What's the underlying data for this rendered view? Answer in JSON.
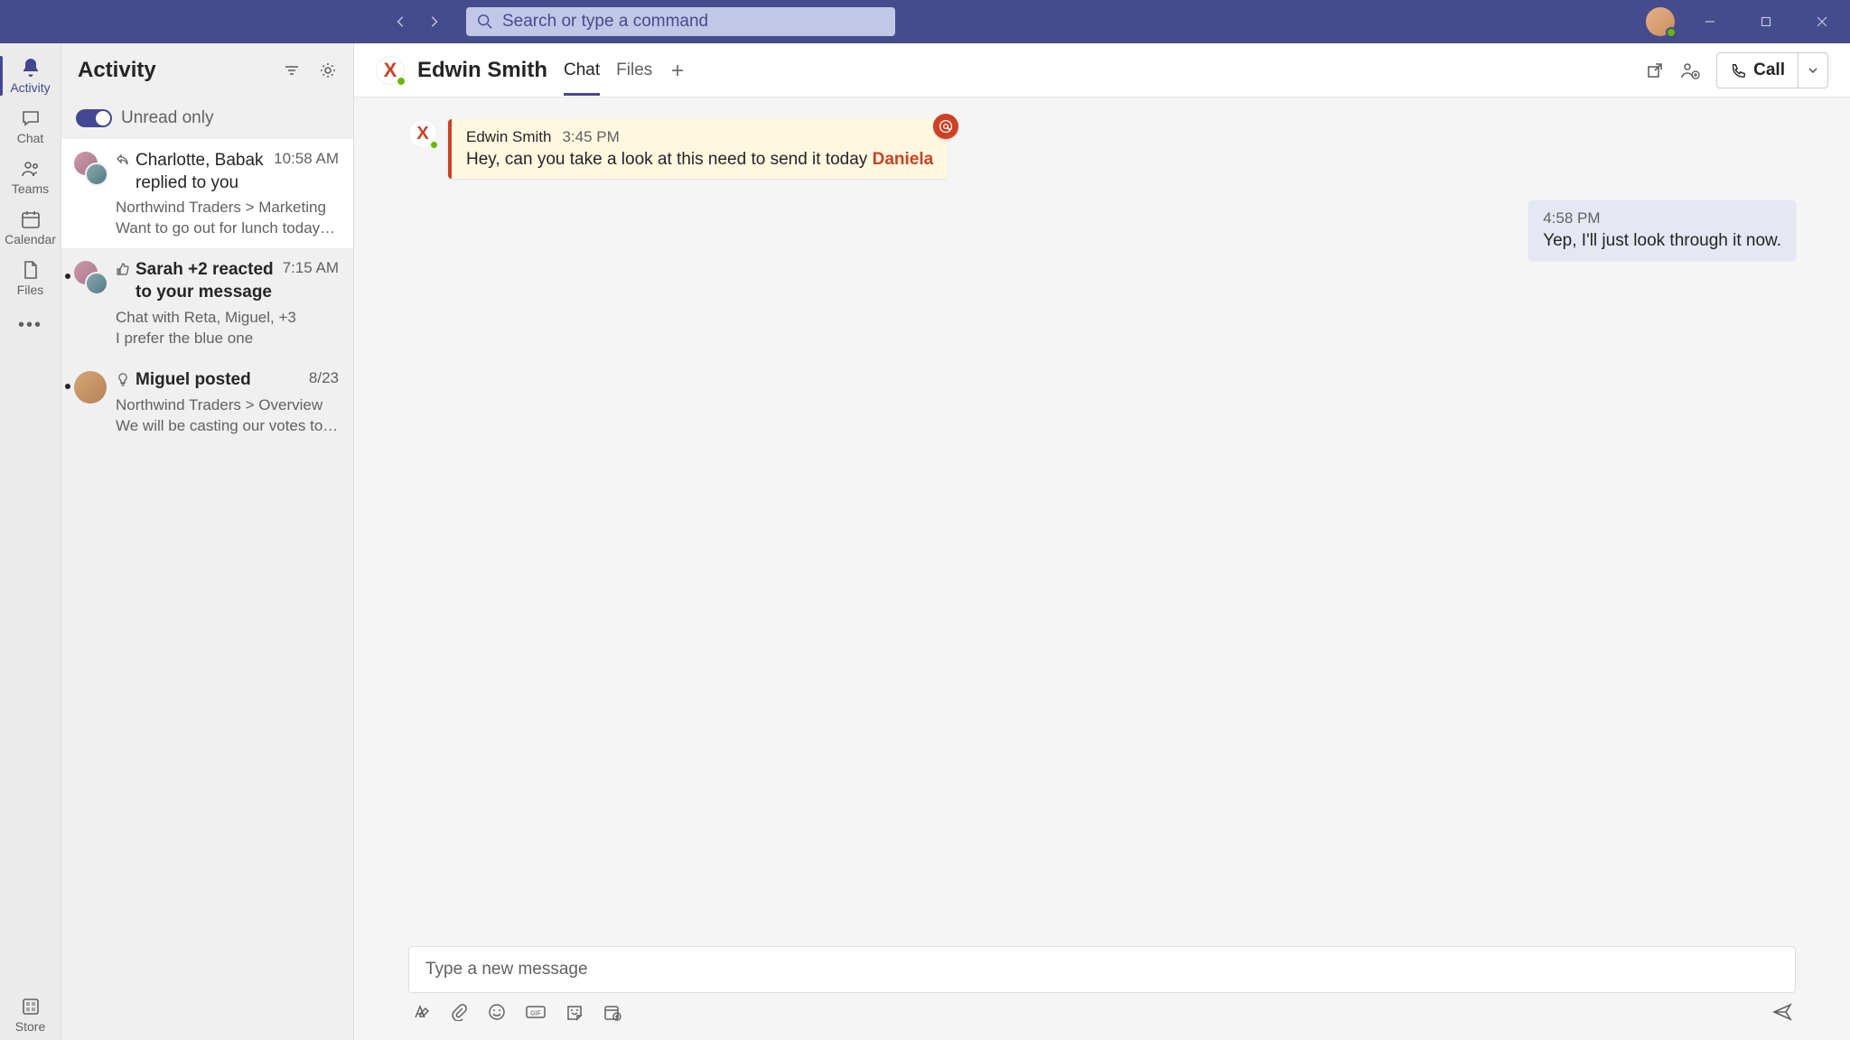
{
  "search": {
    "placeholder": "Search or type a command"
  },
  "rail": {
    "activity": "Activity",
    "chat": "Chat",
    "teams": "Teams",
    "calendar": "Calendar",
    "files": "Files",
    "store": "Store"
  },
  "activity": {
    "title": "Activity",
    "unread_label": "Unread only",
    "items": [
      {
        "heading": "Charlotte, Babak replied to you",
        "time": "10:58 AM",
        "sub": "Northwind Traders > Marketing",
        "preview": "Want to go out for lunch today? It's my…",
        "bold": false,
        "selected": true,
        "dot": false
      },
      {
        "heading": "Sarah +2 reacted to your message",
        "time": "7:15 AM",
        "sub": "Chat with Reta, Miguel, +3",
        "preview": "I prefer the blue one",
        "bold": true,
        "selected": false,
        "dot": true
      },
      {
        "heading": "Miguel posted",
        "time": "8/23",
        "sub": "Northwind Traders > Overview",
        "preview": "We will be casting our votes today, every…",
        "bold": true,
        "selected": false,
        "dot": true
      }
    ]
  },
  "chat": {
    "header": {
      "name": "Edwin Smith",
      "tabs": [
        "Chat",
        "Files"
      ],
      "call_label": "Call"
    },
    "messages": [
      {
        "sender": "Edwin Smith",
        "time": "3:45 PM",
        "text": "Hey, can you take a look at this need to send it today ",
        "mention": "Daniela",
        "mine": false,
        "mention_badge": true
      },
      {
        "time": "4:58 PM",
        "text": "Yep, I'll just look through it now.",
        "mine": true
      }
    ],
    "compose": {
      "placeholder": "Type a new message"
    }
  }
}
